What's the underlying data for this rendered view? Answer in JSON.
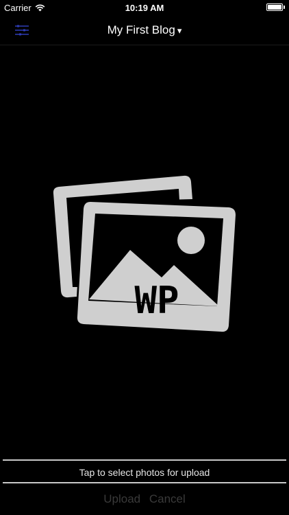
{
  "status_bar": {
    "carrier": "Carrier",
    "time": "10:19 AM",
    "battery_level": 1.0
  },
  "nav": {
    "menu_icon": "menu-icon",
    "title": "My First Blog",
    "title_caret": "▾"
  },
  "placeholder": {
    "logo_text": "WP",
    "icon": "photos-icon"
  },
  "upload": {
    "hint": "Tap to select photos for upload",
    "upload_label": "Upload",
    "cancel_label": "Cancel"
  },
  "colors": {
    "background": "#000000",
    "art": "#cfcfcf",
    "menu_icon": "#2f3db8",
    "disabled_action": "#3a3a3a"
  }
}
